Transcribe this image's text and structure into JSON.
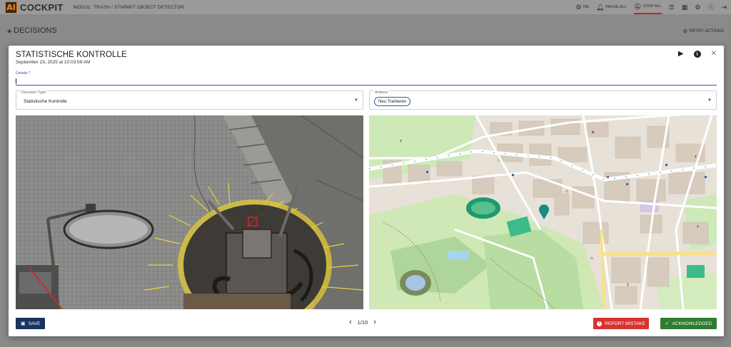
{
  "app": {
    "brand": "COCKPIT",
    "logo_letter": "AI",
    "module": "MODUL: TRASH / STARWIT OBJECT DETECTOR"
  },
  "topbar": {
    "on_label": "ON",
    "pause_label": "PAUSE ALL",
    "stop_label": "STOP ALL",
    "icons": [
      "list-icon",
      "map-icon",
      "gear-icon",
      "info-icon",
      "logout-icon"
    ]
  },
  "page": {
    "title": "DECISIONS",
    "retry_label": "RETRY ACTIONS"
  },
  "modal": {
    "title": "STATISTISCHE KONTROLLE",
    "timestamp": "September 23, 2025 at 10:03:59 AM",
    "details_label": "Details *",
    "details_value": "",
    "decision_type_label": "Decision Type",
    "decision_type_value": "Statistische Kontrolle",
    "actions_label": "Actions",
    "actions_chip": "Neu Trainieren",
    "save_label": "SAVE",
    "pager_text": "1/10",
    "report_label": "REPORT MISTAKE",
    "ack_label": "ACKNOWLEDGED"
  },
  "colors": {
    "primary": "#19335e",
    "danger": "#d9312e",
    "success": "#2e7d32",
    "stop_indicator": "#c0262a",
    "map_marker": "#1a8a82"
  }
}
